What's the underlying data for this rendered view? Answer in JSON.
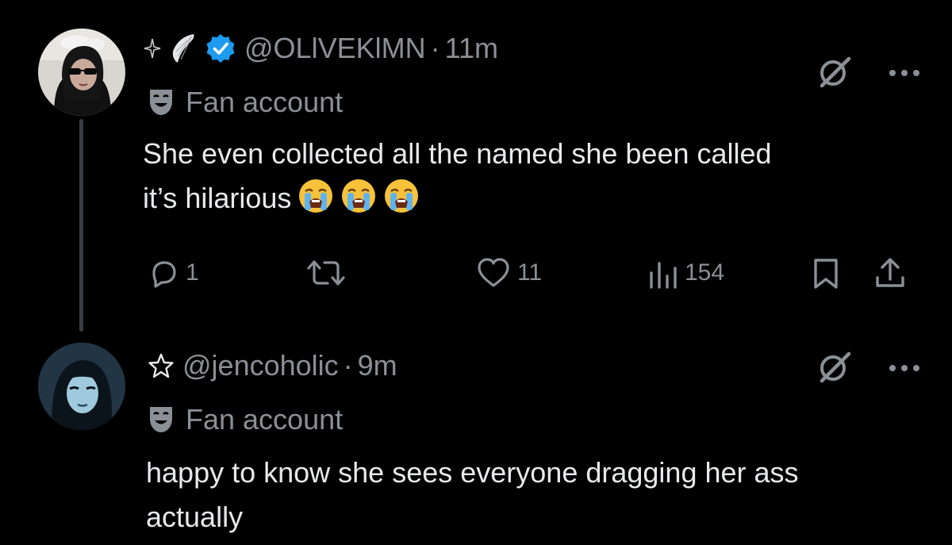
{
  "colors": {
    "background": "#000000",
    "text_primary": "#e7e9ea",
    "text_secondary": "#8b9096",
    "verified_blue": "#1d9bf0",
    "thread_line": "#3a3d41"
  },
  "tweets": [
    {
      "handle": "@OLlVEKlMN",
      "separator": "·",
      "time": "11m",
      "verified": true,
      "decoration_icons": [
        "sparkle-icon",
        "angel-wing-icon"
      ],
      "label": "Fan account",
      "label_icon": "theater-masks-icon",
      "text_lines": [
        "She even collected all the named she been called",
        "it’s hilarious"
      ],
      "trailing_emoji": [
        "crying-face-icon",
        "crying-face-icon",
        "crying-face-icon"
      ],
      "actions": {
        "replies": "1",
        "retweets": "",
        "likes": "11",
        "views": "154"
      }
    },
    {
      "handle": "@jencoholic",
      "separator": "·",
      "time": "9m",
      "verified": false,
      "decoration_icons": [
        "star-outline-icon"
      ],
      "label": "Fan account",
      "label_icon": "theater-masks-icon",
      "text_lines": [
        "happy to know she sees everyone dragging her ass",
        "actually"
      ]
    }
  ]
}
